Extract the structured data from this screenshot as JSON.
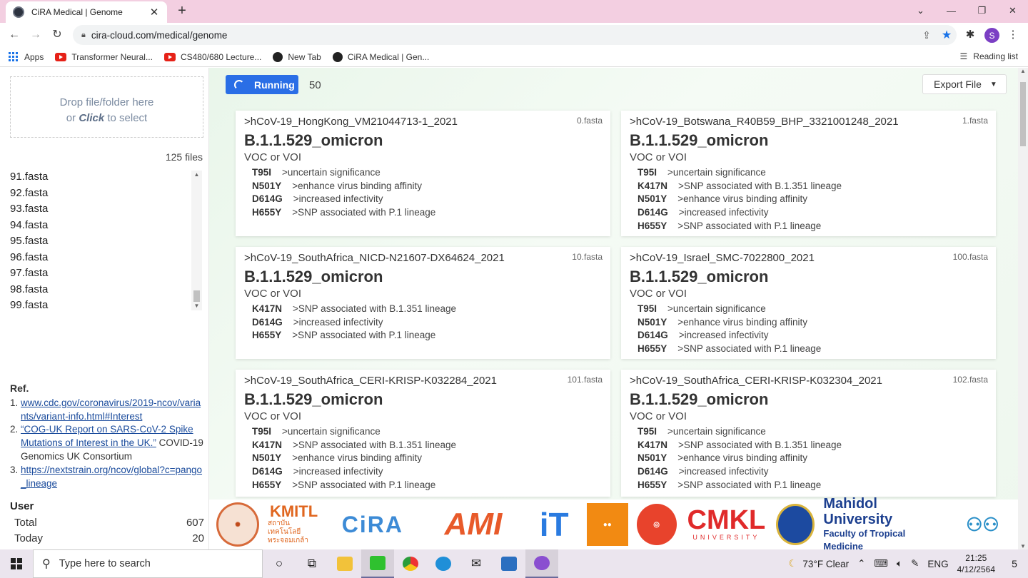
{
  "browser": {
    "tab_title": "CiRA Medical | Genome",
    "tab_close": "✕",
    "new_tab": "+",
    "url": "cira-cloud.com/medical/genome",
    "profile_initial": "S",
    "bookmarks": [
      "Apps",
      "Transformer Neural...",
      "CS480/680 Lecture...",
      "New Tab",
      "CiRA Medical | Gen..."
    ],
    "reading_list": "Reading list"
  },
  "sidebar": {
    "drop_line1": "Drop file/folder here",
    "drop_or": "or ",
    "drop_click": "Click",
    "drop_rest": " to select",
    "file_count": "125 files",
    "files": [
      "91.fasta",
      "92.fasta",
      "93.fasta",
      "94.fasta",
      "95.fasta",
      "96.fasta",
      "97.fasta",
      "98.fasta",
      "99.fasta"
    ],
    "ref_title": "Ref.",
    "refs": [
      {
        "num": "1.",
        "text": "www.cdc.gov/coronavirus/2019-ncov/variants/variant-info.html#Interest"
      },
      {
        "num": "2.",
        "link": "“COG-UK Report on SARS-CoV-2 Spike Mutations of Interest in the UK.”",
        "text": " COVID-19 Genomics UK Consortium"
      },
      {
        "num": "3.",
        "text": "https://nextstrain.org/ncov/global?c=pango_lineage"
      }
    ],
    "user_title": "User",
    "user_stats": [
      {
        "label": "Total",
        "value": "607"
      },
      {
        "label": "Today",
        "value": "20"
      }
    ]
  },
  "main": {
    "running_label": "Running",
    "running_count": "50",
    "export_label": "Export File",
    "cards": [
      {
        "name": ">hCoV-19_HongKong_VM21044713-1_2021",
        "file": "0.fasta",
        "lineage": "B.1.1.529_omicron",
        "voc": "VOC or VOI",
        "mutations": [
          {
            "code": "T95I",
            "desc": ">uncertain significance"
          },
          {
            "code": "N501Y",
            "desc": ">enhance virus binding affinity"
          },
          {
            "code": "D614G",
            "desc": ">increased infectivity"
          },
          {
            "code": "H655Y",
            "desc": ">SNP associated with P.1 lineage"
          }
        ]
      },
      {
        "name": ">hCoV-19_Botswana_R40B59_BHP_3321001248_2021",
        "file": "1.fasta",
        "lineage": "B.1.1.529_omicron",
        "voc": "VOC or VOI",
        "mutations": [
          {
            "code": "T95I",
            "desc": ">uncertain significance"
          },
          {
            "code": "K417N",
            "desc": ">SNP associated with B.1.351 lineage"
          },
          {
            "code": "N501Y",
            "desc": ">enhance virus binding affinity"
          },
          {
            "code": "D614G",
            "desc": ">increased infectivity"
          },
          {
            "code": "H655Y",
            "desc": ">SNP associated with P.1 lineage"
          }
        ]
      },
      {
        "name": ">hCoV-19_SouthAfrica_NICD-N21607-DX64624_2021",
        "file": "10.fasta",
        "lineage": "B.1.1.529_omicron",
        "voc": "VOC or VOI",
        "mutations": [
          {
            "code": "K417N",
            "desc": ">SNP associated with B.1.351 lineage"
          },
          {
            "code": "D614G",
            "desc": ">increased infectivity"
          },
          {
            "code": "H655Y",
            "desc": ">SNP associated with P.1 lineage"
          }
        ]
      },
      {
        "name": ">hCoV-19_Israel_SMC-7022800_2021",
        "file": "100.fasta",
        "lineage": "B.1.1.529_omicron",
        "voc": "VOC or VOI",
        "mutations": [
          {
            "code": "T95I",
            "desc": ">uncertain significance"
          },
          {
            "code": "N501Y",
            "desc": ">enhance virus binding affinity"
          },
          {
            "code": "D614G",
            "desc": ">increased infectivity"
          },
          {
            "code": "H655Y",
            "desc": ">SNP associated with P.1 lineage"
          }
        ]
      },
      {
        "name": ">hCoV-19_SouthAfrica_CERI-KRISP-K032284_2021",
        "file": "101.fasta",
        "lineage": "B.1.1.529_omicron",
        "voc": "VOC or VOI",
        "mutations": [
          {
            "code": "T95I",
            "desc": ">uncertain significance"
          },
          {
            "code": "K417N",
            "desc": ">SNP associated with B.1.351 lineage"
          },
          {
            "code": "N501Y",
            "desc": ">enhance virus binding affinity"
          },
          {
            "code": "D614G",
            "desc": ">increased infectivity"
          },
          {
            "code": "H655Y",
            "desc": ">SNP associated with P.1 lineage"
          }
        ]
      },
      {
        "name": ">hCoV-19_SouthAfrica_CERI-KRISP-K032304_2021",
        "file": "102.fasta",
        "lineage": "B.1.1.529_omicron",
        "voc": "VOC or VOI",
        "mutations": [
          {
            "code": "T95I",
            "desc": ">uncertain significance"
          },
          {
            "code": "K417N",
            "desc": ">SNP associated with B.1.351 lineage"
          },
          {
            "code": "N501Y",
            "desc": ">enhance virus binding affinity"
          },
          {
            "code": "D614G",
            "desc": ">increased infectivity"
          },
          {
            "code": "H655Y",
            "desc": ">SNP associated with P.1 lineage"
          }
        ]
      }
    ]
  },
  "logos": {
    "kmitl": "KMITL",
    "kmitl_thai": "สถาบันเทคโนโลยีพระจอมเกล้า",
    "cira": "CiRA",
    "ami": "AMI",
    "it": "iT",
    "cmkl": "CMKL",
    "cmkl_sub": "UNIVERSITY",
    "mahidol": "Mahidol University",
    "mahidol_sub": "Faculty of Tropical Medicine"
  },
  "taskbar": {
    "search_placeholder": "Type here to search",
    "weather": "73°F  Clear",
    "lang": "ENG",
    "time": "21:25",
    "date": "4/12/2564",
    "notif_count": "5"
  },
  "colors": {
    "accent": "#2a6ee6",
    "tabbar": "#f3cfe1",
    "main_bg": "#e9f6ea"
  }
}
